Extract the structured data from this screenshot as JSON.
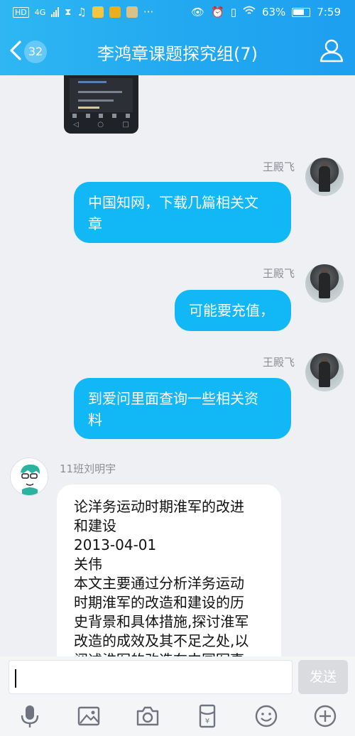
{
  "status_bar": {
    "left_badges": [
      "HD",
      "4G"
    ],
    "battery": "63%",
    "time": "7:59"
  },
  "header": {
    "unread_count": "32",
    "title": "李鸿章课题探究组(7)"
  },
  "messages": [
    {
      "sender": "王殿飞",
      "text": "中国知网，下载几篇相关文章",
      "line1": "中国知网，下载几篇相关文",
      "line2": "章",
      "side": "right"
    },
    {
      "sender": "王殿飞",
      "text": "可能要充值，",
      "side": "right"
    },
    {
      "sender": "王殿飞",
      "text": "到爱问里面查询一些相关资料",
      "line1": "到爱问里面查询一些相关资",
      "line2": "料",
      "side": "right"
    },
    {
      "sender": "11班刘明宇",
      "side": "left",
      "lines": [
        "论洋务运动时期淮军的改进",
        "和建设",
        "2013-04-01",
        "关伟",
        "本文主要通过分析洋务运动",
        "时期淮军的改造和建设的历",
        "史背景和具体措施,探讨淮军",
        "改造的成效及其不足之处,以",
        "阐述淮军的改造在中国军事"
      ]
    }
  ],
  "input": {
    "value": "",
    "send_label": "发送"
  },
  "toolbar": {
    "icons": [
      "microphone-icon",
      "image-icon",
      "camera-icon",
      "red-packet-icon",
      "emoji-icon",
      "plus-icon"
    ]
  },
  "colors": {
    "header_blue": "#22a9f0",
    "bubble_blue": "#12b7f5",
    "background": "#eef0f4"
  }
}
